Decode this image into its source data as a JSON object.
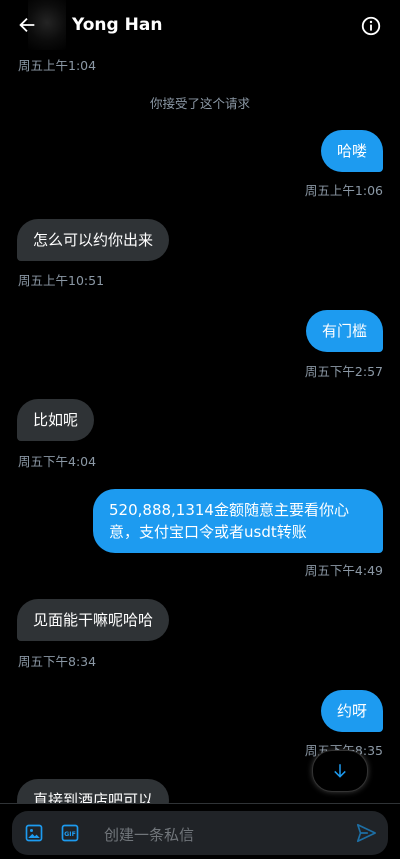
{
  "header": {
    "title": "Yong Han"
  },
  "system_message": "你接受了这个请求",
  "messages": [
    {
      "dir": "out",
      "text": "哈喽",
      "time": "周五上午1:06"
    },
    {
      "dir": "in",
      "text": "怎么可以约你出来",
      "time": "周五上午10:51"
    },
    {
      "dir": "out",
      "text": "有门槛",
      "time": "周五下午2:57"
    },
    {
      "dir": "in",
      "text": "比如呢",
      "time": "周五下午4:04"
    },
    {
      "dir": "out",
      "text_line1": "520,888,1314金额随意主要看你心",
      "text_line2": "意，支付宝口令或者usdt转账",
      "time": "周五下午4:49"
    },
    {
      "dir": "in",
      "text": "见面能干嘛呢哈哈",
      "time": "周五下午8:34"
    },
    {
      "dir": "out",
      "text": "约呀",
      "time": "周五下午8:35"
    },
    {
      "dir": "in",
      "text": "直接到酒店吧可以"
    }
  ],
  "first_time": "周五上午1:04",
  "composer": {
    "placeholder": "创建一条私信"
  },
  "colors": {
    "accent": "#1d9bf0",
    "incoming_bubble": "#2f3336",
    "background": "#000000"
  },
  "icons": {
    "back": "arrow-left-icon",
    "info": "info-icon",
    "image": "image-icon",
    "gif": "gif-icon",
    "send": "send-icon",
    "scroll": "arrow-down-icon"
  }
}
